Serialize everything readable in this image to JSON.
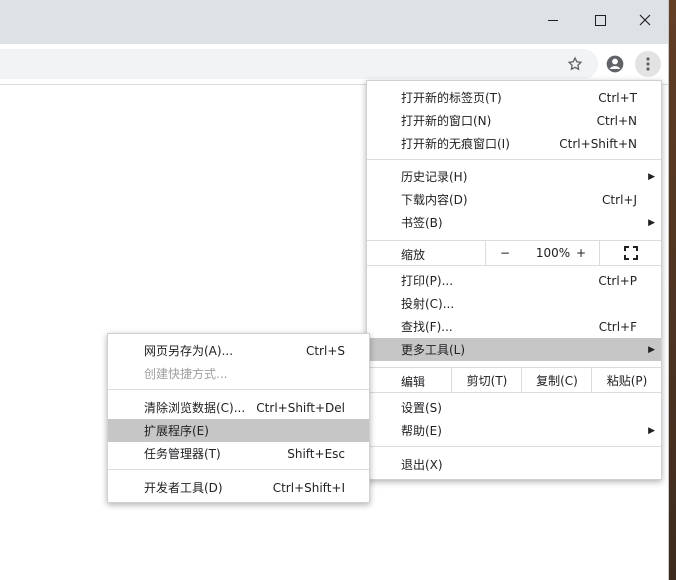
{
  "window_controls": {
    "minimize": "—",
    "maximize": "☐",
    "close": "✕"
  },
  "toolbar": {
    "star_icon": "☆",
    "profile_icon": "account-circle",
    "menu_icon": "⋮"
  },
  "main_menu": {
    "new_tab": {
      "label": "打开新的标签页(T)",
      "shortcut": "Ctrl+T"
    },
    "new_window": {
      "label": "打开新的窗口(N)",
      "shortcut": "Ctrl+N"
    },
    "new_incognito": {
      "label": "打开新的无痕窗口(I)",
      "shortcut": "Ctrl+Shift+N"
    },
    "history": {
      "label": "历史记录(H)"
    },
    "downloads": {
      "label": "下载内容(D)",
      "shortcut": "Ctrl+J"
    },
    "bookmarks": {
      "label": "书签(B)"
    },
    "zoom": {
      "label": "缩放",
      "minus": "−",
      "value": "100%",
      "plus": "+"
    },
    "print": {
      "label": "打印(P)...",
      "shortcut": "Ctrl+P"
    },
    "cast": {
      "label": "投射(C)..."
    },
    "find": {
      "label": "查找(F)...",
      "shortcut": "Ctrl+F"
    },
    "more_tools": {
      "label": "更多工具(L)"
    },
    "edit": {
      "label": "编辑",
      "cut": "剪切(T)",
      "copy": "复制(C)",
      "paste": "粘贴(P)"
    },
    "settings": {
      "label": "设置(S)"
    },
    "help": {
      "label": "帮助(E)"
    },
    "exit": {
      "label": "退出(X)"
    }
  },
  "sub_menu": {
    "save_page": {
      "label": "网页另存为(A)...",
      "shortcut": "Ctrl+S"
    },
    "create_shortcut": {
      "label": "创建快捷方式..."
    },
    "clear_data": {
      "label": "清除浏览数据(C)...",
      "shortcut": "Ctrl+Shift+Del"
    },
    "extensions": {
      "label": "扩展程序(E)"
    },
    "task_manager": {
      "label": "任务管理器(T)",
      "shortcut": "Shift+Esc"
    },
    "dev_tools": {
      "label": "开发者工具(D)",
      "shortcut": "Ctrl+Shift+I"
    }
  }
}
